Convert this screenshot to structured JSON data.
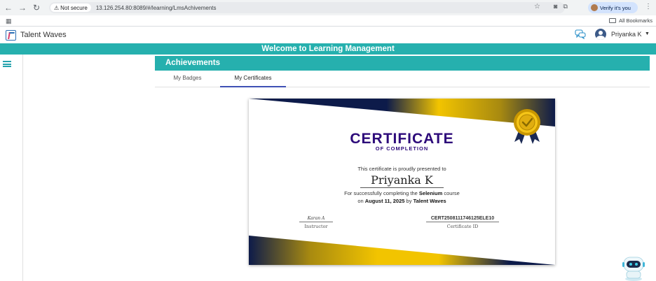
{
  "browser": {
    "not_secure": "Not secure",
    "url": "13.126.254.80:8089/#/learning/LmsAchivements",
    "verify": "Verify it's you",
    "all_bookmarks": "All Bookmarks"
  },
  "header": {
    "brand": "Talent Waves",
    "user_name": "Priyanka K"
  },
  "welcome": "Welcome to Learning Management",
  "page": {
    "section_title": "Achievements",
    "tabs": [
      "My Badges",
      "My Certificates"
    ],
    "active_tab": "My Certificates"
  },
  "certificate": {
    "title": "CERTIFICATE",
    "subtitle": "OF COMPLETION",
    "presented": "This certificate is proudly presented to",
    "recipient": "Priyanka K",
    "line1_prefix": "For successfully completing the",
    "course": "Selenium",
    "line1_suffix": "course",
    "line2_prefix": "on",
    "date": "August 11, 2025",
    "line2_mid": "by",
    "issuer": "Talent Waves",
    "signature": "Karan A",
    "signature_label": "Instructor",
    "certificate_id": "CERT2508111746125ELE10",
    "certificate_id_label": "Certificate ID"
  },
  "colors": {
    "teal": "#26b0ae",
    "navy": "#0d1b4a",
    "gold": "#f2c400",
    "title_purple": "#2d0a7a"
  }
}
